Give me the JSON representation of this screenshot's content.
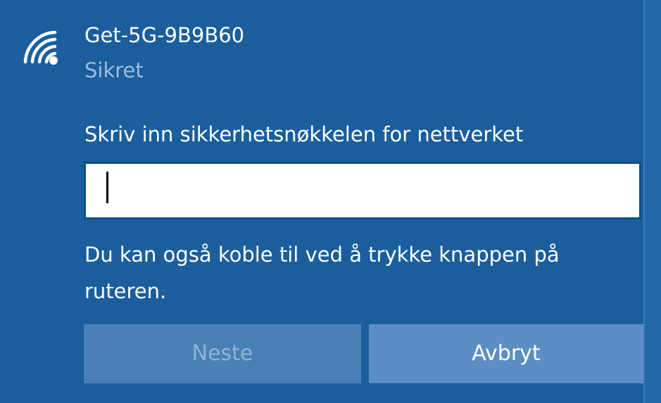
{
  "network": {
    "name": "Get-5G-9B9B60",
    "status": "Sikret",
    "icon": "wifi-secure-icon"
  },
  "prompt": {
    "label": "Skriv inn sikkerhetsnøkkelen for nettverket"
  },
  "key_input": {
    "value": "",
    "placeholder": ""
  },
  "hint": {
    "text": "Du kan også koble til ved å trykke knappen på ruteren."
  },
  "buttons": {
    "next_label": "Neste",
    "cancel_label": "Avbryt"
  },
  "colors": {
    "background": "#1b5e9d",
    "next_button_disabled": "#4a80b8",
    "cancel_button": "#5b8ec5",
    "secondary_text": "#9fbbd7"
  }
}
